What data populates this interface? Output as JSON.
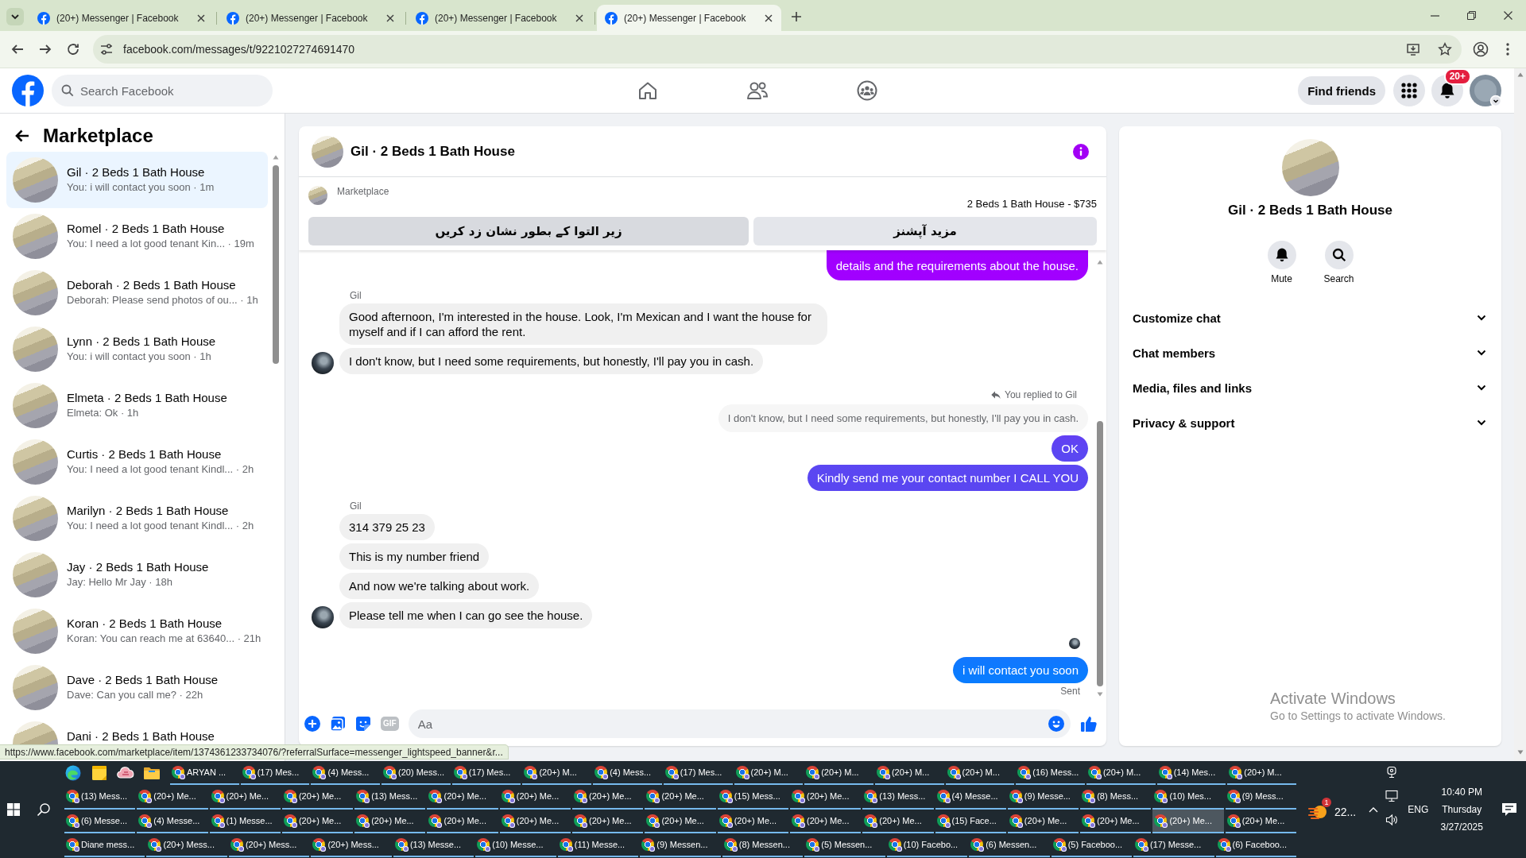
{
  "browser": {
    "tabs": [
      {
        "title": "(20+) Messenger | Facebook",
        "selected": false
      },
      {
        "title": "(20+) Messenger | Facebook",
        "selected": false
      },
      {
        "title": "(20+) Messenger | Facebook",
        "selected": false
      },
      {
        "title": "(20+) Messenger | Facebook",
        "selected": true
      }
    ],
    "address": "facebook.com/messages/t/9221027274691470"
  },
  "header": {
    "search": {
      "placeholder": "Search Facebook"
    },
    "find_friends": "Find friends",
    "notification_badge": "20+"
  },
  "sidebar": {
    "title": "Marketplace",
    "conversations": [
      {
        "name": "Gil · 2 Beds 1 Bath House",
        "preview": "You: i will contact you soon · 1m",
        "selected": true
      },
      {
        "name": "Romel · 2 Beds 1 Bath House",
        "preview": "You: I need a lot good tenant Kin... · 19m",
        "selected": false
      },
      {
        "name": "Deborah · 2 Beds 1 Bath House",
        "preview": "Deborah: Please send photos of ou... · 1h",
        "selected": false
      },
      {
        "name": "Lynn · 2 Beds 1 Bath House",
        "preview": "You: i will contact you soon · 1h",
        "selected": false
      },
      {
        "name": "Elmeta · 2 Beds 1 Bath House",
        "preview": "Elmeta: Ok · 1h",
        "selected": false
      },
      {
        "name": "Curtis · 2 Beds 1 Bath House",
        "preview": "You: I need a lot good tenant Kindl... · 2h",
        "selected": false
      },
      {
        "name": "Marilyn · 2 Beds 1 Bath House",
        "preview": "You: I need a lot good tenant Kindl... · 2h",
        "selected": false
      },
      {
        "name": "Jay · 2 Beds 1 Bath House",
        "preview": "Jay: Hello Mr Jay · 18h",
        "selected": false
      },
      {
        "name": "Koran · 2 Beds 1 Bath House",
        "preview": "Koran: You can reach me at 63640... · 21h",
        "selected": false
      },
      {
        "name": "Dave · 2 Beds 1 Bath House",
        "preview": "Dave: Can you call me? · 22h",
        "selected": false
      },
      {
        "name": "Dani · 2 Beds 1 Bath House",
        "selected": false
      }
    ]
  },
  "chat": {
    "title": "Gil · 2 Beds 1 Bath House",
    "banner": {
      "label": "Marketplace",
      "listing": "2 Beds 1 Bath House - $735",
      "buttons": [
        {
          "label": "مزید آپشنز",
          "hovered": false
        },
        {
          "label": "زیر التوا کے بطور نشان زد کریں",
          "hovered": true
        }
      ]
    },
    "messages": [
      {
        "kind": "outgoing",
        "text": "details and the requirements about the house."
      },
      {
        "kind": "sender",
        "text": "Gil"
      },
      {
        "kind": "incoming",
        "text": "Good afternoon, I'm interested in the house. Look, I'm Mexican and I want the house for myself and if I can afford the rent.",
        "avatar": false
      },
      {
        "kind": "incoming",
        "text": "I don't know, but I need some requirements, but honestly, I'll pay you in cash.",
        "avatar": true
      },
      {
        "kind": "reply_note",
        "text": "You replied to Gil"
      },
      {
        "kind": "quoted",
        "text": "I don't know, but I need some requirements, but honestly, I'll pay you in cash."
      },
      {
        "kind": "outgoing",
        "text": "OK"
      },
      {
        "kind": "outgoing",
        "text": "Kindly send me your contact number I CALL YOU"
      },
      {
        "kind": "sender",
        "text": "Gil"
      },
      {
        "kind": "incoming",
        "text": "314 379 25 23",
        "avatar": false
      },
      {
        "kind": "incoming",
        "text": "This is my number friend",
        "avatar": false
      },
      {
        "kind": "incoming",
        "text": "And now we're talking about work.",
        "avatar": false
      },
      {
        "kind": "incoming",
        "text": "Please tell me when I can go see the house.",
        "avatar": true
      },
      {
        "kind": "seen"
      },
      {
        "kind": "outgoing",
        "text": "i will contact you soon"
      },
      {
        "kind": "status",
        "text": "Sent"
      }
    ],
    "composer": {
      "placeholder": "Aa",
      "gif": "GIF"
    }
  },
  "details": {
    "title": "Gil · 2 Beds 1 Bath House",
    "actions": [
      {
        "label": "Mute",
        "kind": "bell"
      },
      {
        "label": "Search",
        "kind": "search"
      }
    ],
    "sections": [
      "Customize chat",
      "Chat members",
      "Media, files and links",
      "Privacy & support"
    ]
  },
  "status_url": "https://www.facebook.com/marketplace/item/1374361233734076/?referralSurface=messenger_lightspeed_banner&r...",
  "activation_notice": {
    "title": "Activate Windows",
    "text": "Go to Settings to activate Windows."
  },
  "taskbar": {
    "rows": [
      {
        "items": [
          {
            "label": "ARYAN ...",
            "selected": false
          },
          {
            "label": "(17) Mes...",
            "selected": false
          },
          {
            "label": "(4) Mess...",
            "selected": false
          },
          {
            "label": "(20) Mess...",
            "selected": false
          },
          {
            "label": "(17) Mes...",
            "selected": false
          },
          {
            "label": "(20+) M...",
            "selected": false
          },
          {
            "label": "(4) Mess...",
            "selected": false
          },
          {
            "label": "(17) Mes...",
            "selected": false
          },
          {
            "label": "(20+) M...",
            "selected": false
          },
          {
            "label": "(20+) M...",
            "selected": false
          },
          {
            "label": "(20+) M...",
            "selected": false
          },
          {
            "label": "(20+) M...",
            "selected": false
          },
          {
            "label": "(16) Mess...",
            "selected": false
          },
          {
            "label": "(20+) M...",
            "selected": false
          },
          {
            "label": "(14) Mes...",
            "selected": false
          },
          {
            "label": "(20+) M...",
            "selected": false
          }
        ]
      },
      {
        "items": [
          {
            "label": "(13) Mess...",
            "selected": false
          },
          {
            "label": "(20+) Me...",
            "selected": false
          },
          {
            "label": "(20+) Me...",
            "selected": false
          },
          {
            "label": "(20+) Me...",
            "selected": false
          },
          {
            "label": "(13) Mess...",
            "selected": false
          },
          {
            "label": "(20+) Me...",
            "selected": false
          },
          {
            "label": "(20+) Me...",
            "selected": false
          },
          {
            "label": "(20+) Me...",
            "selected": false
          },
          {
            "label": "(20+) Me...",
            "selected": false
          },
          {
            "label": "(15) Mess...",
            "selected": false
          },
          {
            "label": "(20+) Me...",
            "selected": false
          },
          {
            "label": "(13) Mess...",
            "selected": false
          },
          {
            "label": "(4) Messe...",
            "selected": false
          },
          {
            "label": "(9) Messe...",
            "selected": false
          },
          {
            "label": "(8) Mess...",
            "selected": false
          },
          {
            "label": "(10) Mes...",
            "selected": false
          },
          {
            "label": "(9) Mess...",
            "selected": false
          }
        ]
      },
      {
        "items": [
          {
            "label": "(6) Messe...",
            "selected": false
          },
          {
            "label": "(4) Messe...",
            "selected": false
          },
          {
            "label": "(1) Messe...",
            "selected": false
          },
          {
            "label": "(20+) Me...",
            "selected": false
          },
          {
            "label": "(20+) Me...",
            "selected": false
          },
          {
            "label": "(20+) Me...",
            "selected": false
          },
          {
            "label": "(20+) Me...",
            "selected": false
          },
          {
            "label": "(20+) Me...",
            "selected": false
          },
          {
            "label": "(20+) Me...",
            "selected": false
          },
          {
            "label": "(20+) Me...",
            "selected": false
          },
          {
            "label": "(20+) Me...",
            "selected": false
          },
          {
            "label": "(20+) Me...",
            "selected": false
          },
          {
            "label": "(15) Face...",
            "selected": false
          },
          {
            "label": "(20+) Me...",
            "selected": false
          },
          {
            "label": "(20+) Me...",
            "selected": false
          },
          {
            "label": "(20+) Me...",
            "selected": true
          },
          {
            "label": "(20+) Me...",
            "selected": false
          }
        ]
      },
      {
        "items": [
          {
            "label": "Diane mess...",
            "selected": false
          },
          {
            "label": "(20+) Mess...",
            "selected": false
          },
          {
            "label": "(20+) Mess...",
            "selected": false
          },
          {
            "label": "(20+) Mess...",
            "selected": false
          },
          {
            "label": "(13) Messe...",
            "selected": false
          },
          {
            "label": "(10) Messe...",
            "selected": false
          },
          {
            "label": "(11) Messe...",
            "selected": false
          },
          {
            "label": "(9) Messen...",
            "selected": false
          },
          {
            "label": "(8) Messen...",
            "selected": false
          },
          {
            "label": "(5) Messen...",
            "selected": false
          },
          {
            "label": "(10) Facebo...",
            "selected": false
          },
          {
            "label": "(6) Messen...",
            "selected": false
          },
          {
            "label": "(5) Faceboo...",
            "selected": false
          },
          {
            "label": "(17) Messe...",
            "selected": false
          },
          {
            "label": "(6) Faceboo...",
            "selected": false
          }
        ]
      }
    ],
    "tray": {
      "weather": "22...",
      "weather_badge": "1",
      "language": "ENG",
      "time": "10:40 PM",
      "day": "Thursday",
      "date": "3/27/2025"
    }
  }
}
